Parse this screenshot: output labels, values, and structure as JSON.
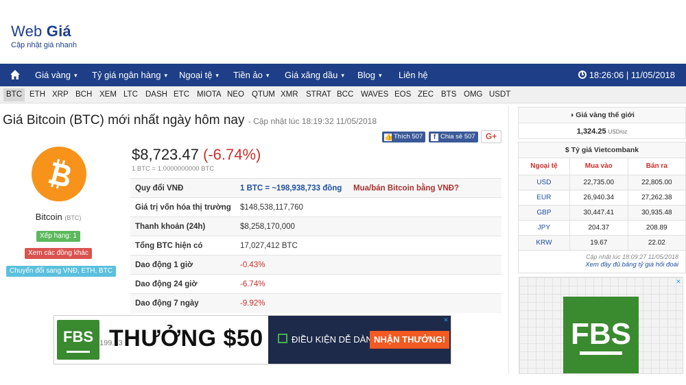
{
  "site": {
    "logo_light": "Web ",
    "logo_bold": "Giá",
    "tagline": "Cập nhật giá nhanh"
  },
  "nav": {
    "items": [
      {
        "label": "Giá vàng",
        "dropdown": true
      },
      {
        "label": "Tỷ giá ngân hàng",
        "dropdown": true
      },
      {
        "label": "Ngoại tệ",
        "dropdown": true
      },
      {
        "label": "Tiền ảo",
        "dropdown": true
      },
      {
        "label": "Giá xăng dầu",
        "dropdown": true
      },
      {
        "label": "Blog",
        "dropdown": true
      },
      {
        "label": "Liên hệ",
        "dropdown": false
      }
    ],
    "caret": "▾",
    "clock": "18:26:06 | 11/05/2018"
  },
  "coins": [
    "BTC",
    "ETH",
    "XRP",
    "BCH",
    "XEM",
    "LTC",
    "DASH",
    "ETC",
    "MIOTA",
    "NEO",
    "QTUM",
    "XMR",
    "STRAT",
    "BCC",
    "WAVES",
    "EOS",
    "ZEC",
    "BTS",
    "OMG",
    "USDT"
  ],
  "main": {
    "title": "Giá Bitcoin (BTC) mới nhất ngày hôm nay",
    "updated": "- Cập nhật lúc 18:19:32 11/05/2018",
    "like_label": "Thích 507",
    "share_label": "Chia sẻ 507",
    "gplus_label": "G+",
    "coin_name": "Bitcoin",
    "coin_symbol": "(BTC)",
    "rank_badge": "Xếp hạng: 1",
    "other_coins_badge": "Xem các đồng khác",
    "convert_badge": "Chuyển đổi sang VNĐ, ETH, BTC",
    "price": "$8,723.47",
    "change": "(-6.74%)",
    "rate": "1 BTC = 1.0000000000 BTC",
    "stats": [
      {
        "label": "Quy đổi VNĐ",
        "value": "1 BTC = ~198,938,733 đồng",
        "extra": "Mua/bán Bitcoin bằng VNĐ?",
        "style": "blue"
      },
      {
        "label": "Giá trị vốn hóa thị trường",
        "value": "$148,538,117,760",
        "extra": "",
        "style": ""
      },
      {
        "label": "Thanh khoản (24h)",
        "value": "$8,258,170,000",
        "extra": "",
        "style": ""
      },
      {
        "label": "Tổng BTC hiện có",
        "value": "17,027,412 BTC",
        "extra": "",
        "style": ""
      },
      {
        "label": "Dao động 1 giờ",
        "value": "-0.43%",
        "extra": "",
        "style": "red"
      },
      {
        "label": "Dao động 24 giờ",
        "value": "-6.74%",
        "extra": "",
        "style": "red"
      },
      {
        "label": "Dao động 7 ngày",
        "value": "-9.92%",
        "extra": "",
        "style": "red"
      }
    ]
  },
  "ad_banner": {
    "logo": "FBS",
    "ghost_value": "199.13",
    "title": "THƯỞNG $50",
    "condition": "ĐIỀU KIỆN DỄ DÀNG",
    "cta": "NHẬN THƯỞNG!",
    "close": "✕"
  },
  "sidebar": {
    "gold_title": "Giá vàng thế giới",
    "gold_value": "1,324.25",
    "gold_unit": "USD/oz",
    "fx_title": "Tỷ giá Vietcombank",
    "fx_headers": [
      "Ngoại tệ",
      "Mua vào",
      "Bán ra"
    ],
    "fx_rows": [
      [
        "USD",
        "22,735.00",
        "22,805.00"
      ],
      [
        "EUR",
        "26,940.34",
        "27,262.38"
      ],
      [
        "GBP",
        "30,447.41",
        "30,935.48"
      ],
      [
        "JPY",
        "204.37",
        "208.89"
      ],
      [
        "KRW",
        "19.67",
        "22.02"
      ]
    ],
    "fx_updated": "Cập nhật lúc 18:09:27 11/05/2018",
    "fx_link": "Xem đầy đủ bảng tỷ giá hối đoái",
    "ad_logo": "FBS",
    "ad_close": "✕"
  },
  "colors": {
    "navbar": "#1e3f87",
    "accent_red": "#c9302c",
    "bitcoin_orange": "#f7931a",
    "fbs_green": "#3a8a2f"
  }
}
